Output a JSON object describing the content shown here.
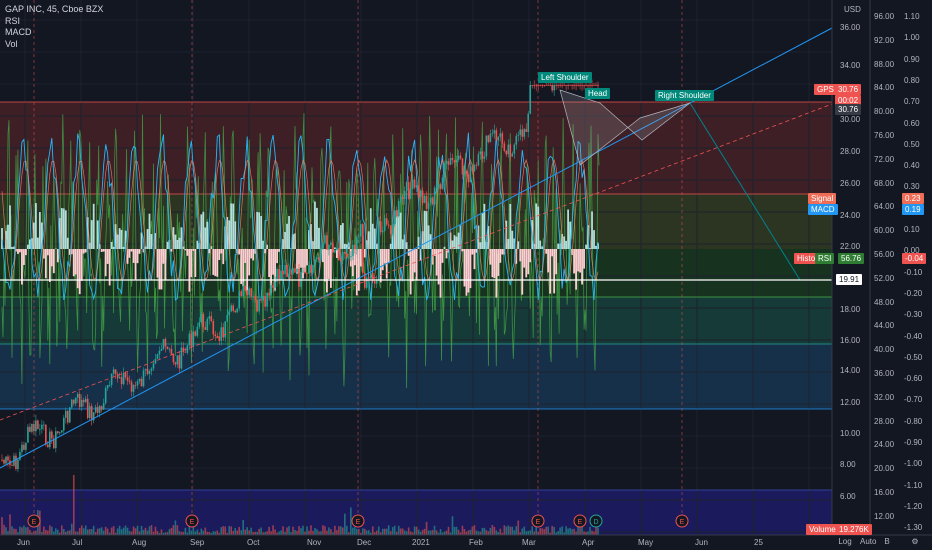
{
  "legend": {
    "title": "GAP INC, 45, Cboe BZX",
    "lines": [
      "RSI",
      "MACD",
      "Vol"
    ]
  },
  "currency": "USD",
  "price_ticks": [
    "96.00",
    "36.00",
    "92.00",
    "34.00",
    "88.00",
    "32.00",
    "84.00",
    "30.00",
    "80.00",
    "28.00",
    "76.00",
    "26.00",
    "72.00",
    "24.00",
    "68.00",
    "64.00",
    "22.00",
    "60.00",
    "56.00",
    "20.00",
    "52.00",
    "18.00",
    "48.00",
    "16.00",
    "44.00",
    "40.00",
    "14.00",
    "36.00",
    "12.00",
    "32.00",
    "10.00",
    "28.00",
    "8.00",
    "24.00",
    "20.00",
    "6.00",
    "16.00",
    "12.00"
  ],
  "macd_ticks": [
    "1.10",
    "1.00",
    "0.90",
    "0.80",
    "0.70",
    "0.60",
    "0.50",
    "0.40",
    "0.30",
    "0.20",
    "0.10",
    "0.00",
    "-0.10",
    "-0.20",
    "-0.30",
    "-0.40",
    "-0.50",
    "-0.60",
    "-0.70",
    "-0.80",
    "-0.90",
    "-1.00",
    "-1.10",
    "-1.20",
    "-1.30"
  ],
  "time_labels": [
    "Jun",
    "Jul",
    "Aug",
    "Sep",
    "Oct",
    "Nov",
    "Dec",
    "2021",
    "Feb",
    "Mar",
    "Apr",
    "May",
    "Jun",
    "25"
  ],
  "events": [
    "E",
    "E",
    "E",
    "E",
    "E",
    "D",
    "E"
  ],
  "annotations": {
    "left_shoulder": "Left Shoulder",
    "head": "Head",
    "right_shoulder": "Right Shoulder"
  },
  "tags": {
    "gps_label": "GPS",
    "gps_value": "30.76",
    "gps_timer": "00:02",
    "gps_value2": "30.76",
    "signal_label": "Signal",
    "signal_value": "0.23",
    "macd_label": "MACD",
    "macd_value": "0.19",
    "histogram_label": "Histogr",
    "rsi_label": "RSI",
    "rsi_value": "56.76",
    "histogram_value": "-0.04",
    "level_value": "19.91",
    "volume_label": "Volume",
    "volume_value": "19.276K"
  },
  "bottom_icons": {
    "log": "Log",
    "auto": "Auto",
    "b": "B",
    "settings": "settings-icon"
  },
  "colors": {
    "bg": "#131722",
    "up": "#26a69a",
    "down": "#ef5350",
    "trend": "#2196f3",
    "label_teal": "#00897b"
  }
}
